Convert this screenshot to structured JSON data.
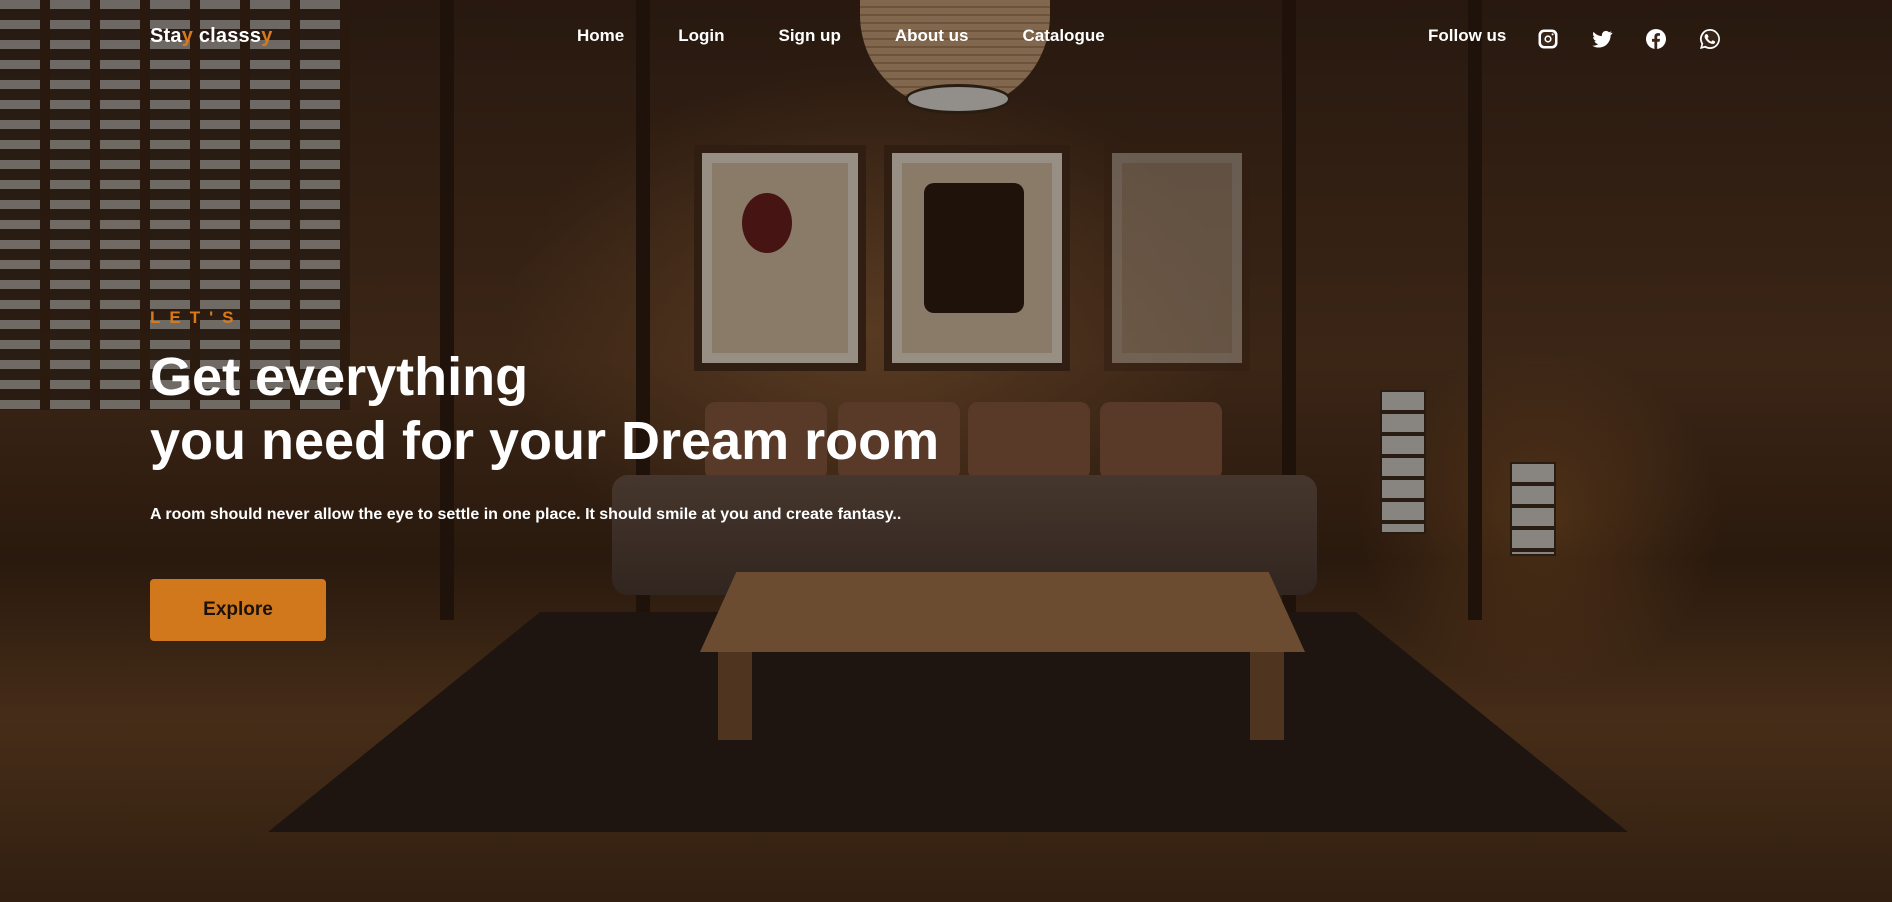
{
  "brand": {
    "logo_part1": "Sta",
    "logo_part2": "y",
    "logo_part3": " class",
    "logo_part4": "s",
    "logo_part5": "y",
    "accent_color": "#d9791a"
  },
  "nav": {
    "items": [
      {
        "label": "Home"
      },
      {
        "label": "Login"
      },
      {
        "label": "Sign up"
      },
      {
        "label": "About us"
      },
      {
        "label": "Catalogue"
      }
    ]
  },
  "social": {
    "label": "Follow us",
    "icons": [
      "instagram-icon",
      "twitter-icon",
      "facebook-icon",
      "whatsapp-icon"
    ]
  },
  "hero": {
    "kicker": "LET'S",
    "headline_line1": "Get everything",
    "headline_line2": "you need for your Dream room",
    "subtext": "A room should never allow the eye to settle in one place. It should smile at you and create fantasy..",
    "cta_label": "Explore",
    "cta_color": "#d1781c"
  }
}
